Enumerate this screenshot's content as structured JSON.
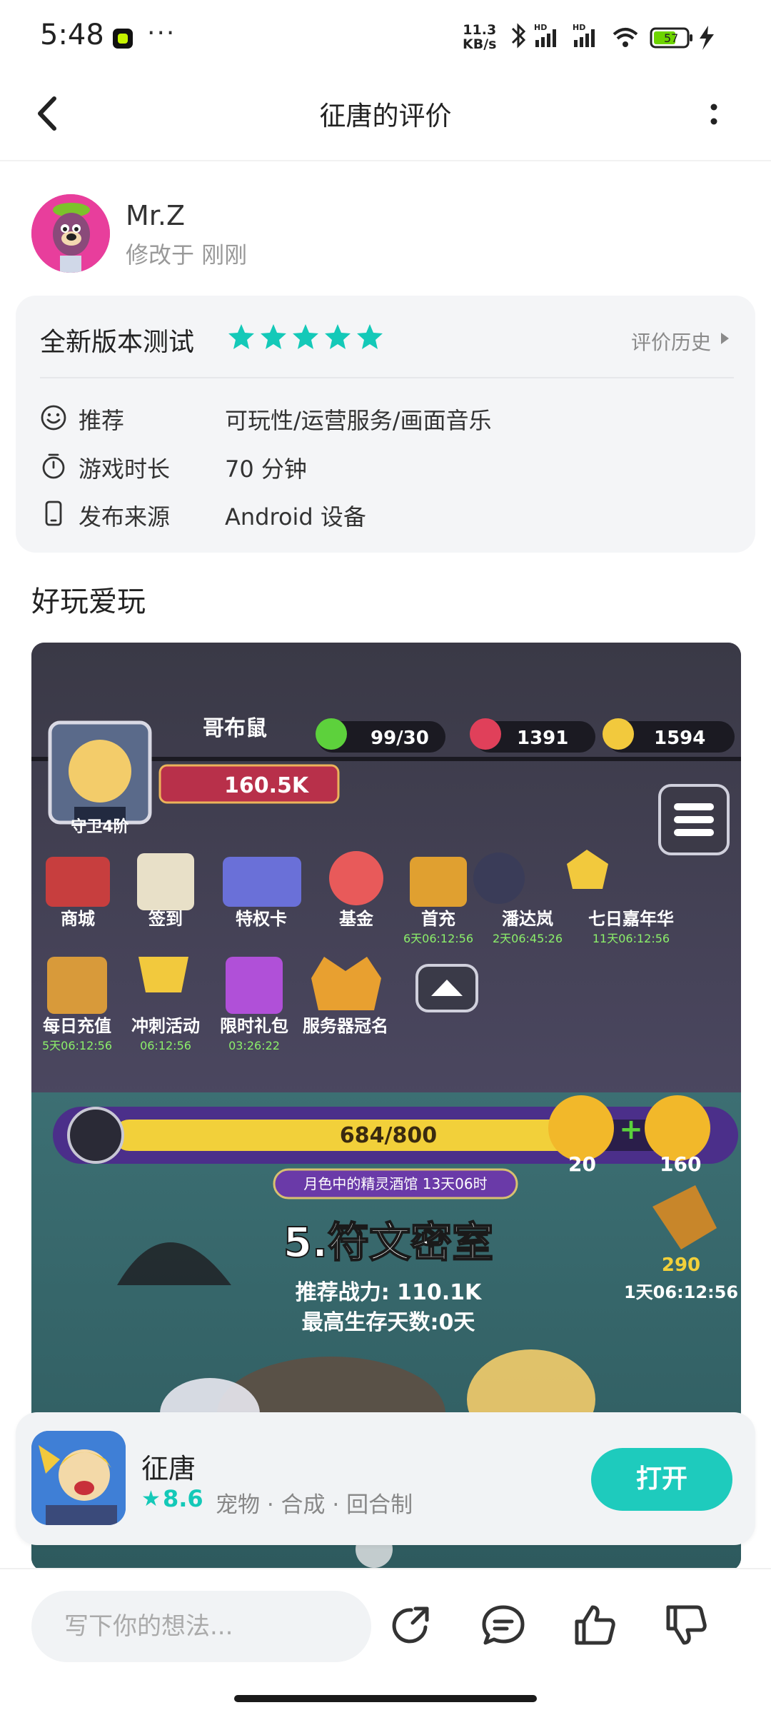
{
  "status_bar": {
    "time": "5:48",
    "speed_value": "11.3",
    "speed_unit": "KB/s",
    "battery": "57"
  },
  "header": {
    "title": "征唐的评价"
  },
  "author": {
    "name": "Mr.Z",
    "meta": "修改于 刚刚"
  },
  "review_card": {
    "title": "全新版本测试",
    "star_count": 5,
    "history_label": "评价历史",
    "rows": [
      {
        "label": "推荐",
        "value": "可玩性/运营服务/画面音乐",
        "icon": "smile-icon"
      },
      {
        "label": "游戏时长",
        "value": "70 分钟",
        "icon": "timer-icon"
      },
      {
        "label": "发布来源",
        "value": "Android 设备",
        "icon": "phone-icon"
      }
    ]
  },
  "review_text": "好玩爱玩",
  "game_screenshot": {
    "player_name": "哥布鼠",
    "power": "160.5K",
    "rank": "守卫4阶",
    "stamina": "99/30",
    "gems": "1391",
    "coins": "1594",
    "menu_row1": [
      {
        "label": "商城",
        "timer": ""
      },
      {
        "label": "签到",
        "timer": ""
      },
      {
        "label": "特权卡",
        "timer": ""
      },
      {
        "label": "基金",
        "timer": ""
      },
      {
        "label": "首充",
        "timer": "6天06:12:56"
      },
      {
        "label": "潘达岚",
        "timer": "2天06:45:26"
      },
      {
        "label": "七日嘉年华",
        "timer": "11天06:12:56"
      }
    ],
    "menu_row2": [
      {
        "label": "每日充值",
        "timer": "5天06:12:56"
      },
      {
        "label": "冲刺活动",
        "timer": "06:12:56"
      },
      {
        "label": "限时礼包",
        "timer": "03:26:22"
      },
      {
        "label": "服务器冠名",
        "timer": ""
      }
    ],
    "progress": "684/800",
    "progress_fraction": 0.855,
    "energy_a": "20",
    "energy_b": "160",
    "tavern_label": "月色中的精灵酒馆 13天06时",
    "stage_title": "5.符文密室",
    "recommended_power": "推荐战力: 110.1K",
    "survival_days": "最高生存天数:0天",
    "fish_count": "290",
    "fish_timer": "1天06:12:56"
  },
  "app_banner": {
    "name": "征唐",
    "score": "8.6",
    "tags": "宠物 · 合成 · 回合制",
    "open_label": "打开"
  },
  "bottom_bar": {
    "comment_placeholder": "写下你的想法..."
  },
  "colors": {
    "accent": "#1ecbbd",
    "star": "#14c9b8"
  }
}
